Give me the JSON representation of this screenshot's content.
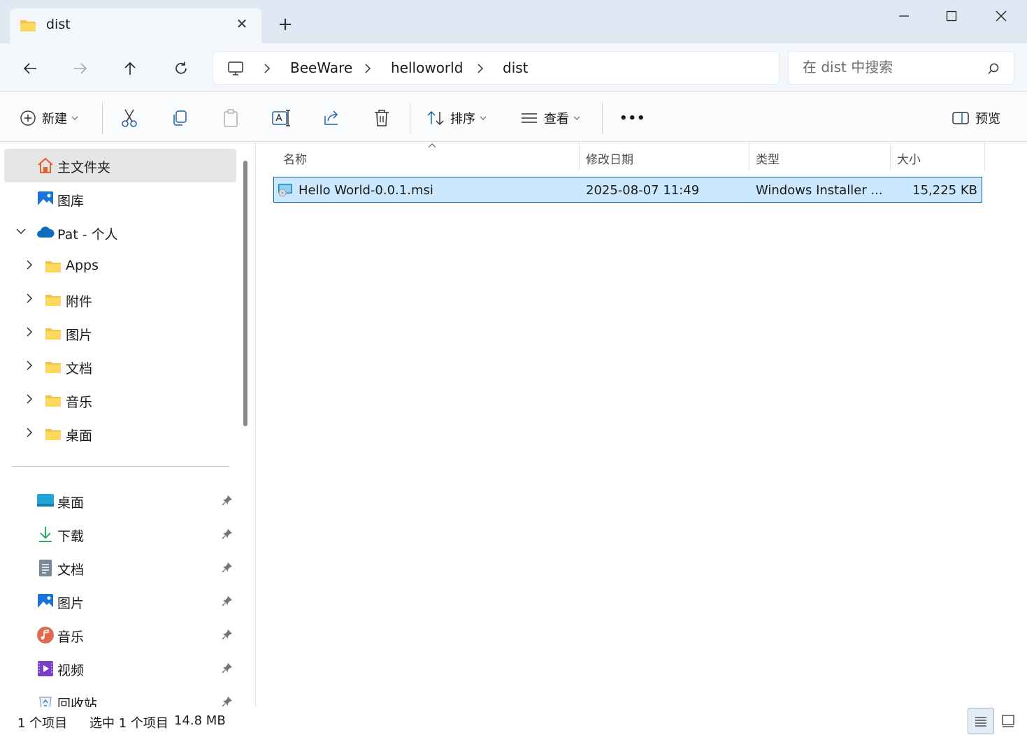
{
  "tab": {
    "title": "dist"
  },
  "address": {
    "crumbs": [
      "BeeWare",
      "helloworld",
      "dist"
    ]
  },
  "search": {
    "placeholder": "在 dist 中搜索"
  },
  "toolbar": {
    "new_label": "新建",
    "sort_label": "排序",
    "view_label": "查看",
    "more_label": "•••",
    "preview_label": "预览"
  },
  "sidebar": {
    "home": "主文件夹",
    "gallery": "图库",
    "onedrive": "Pat - 个人",
    "cloud_folders": [
      "Apps",
      "附件",
      "图片",
      "文档",
      "音乐",
      "桌面"
    ],
    "quick_access": [
      "桌面",
      "下载",
      "文档",
      "图片",
      "音乐",
      "视频",
      "回收站"
    ]
  },
  "columns": {
    "name": "名称",
    "date": "修改日期",
    "type": "类型",
    "size": "大小"
  },
  "files": [
    {
      "name": "Hello World-0.0.1.msi",
      "date": "2025-08-07 11:49",
      "type": "Windows Installer ...",
      "size": "15,225 KB"
    }
  ],
  "status": {
    "count": "1 个项目",
    "selected": "选中 1 个项目",
    "selected_size": "14.8 MB"
  },
  "colors": {
    "accent": "#0b5ba8",
    "selection": "#cce8ff",
    "folder": "#f4c542"
  }
}
